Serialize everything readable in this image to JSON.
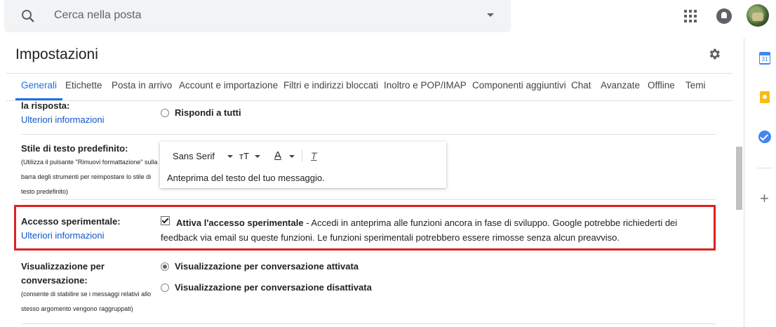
{
  "search": {
    "placeholder": "Cerca nella posta"
  },
  "header": {
    "title": "Impostazioni"
  },
  "tabs": [
    {
      "label": "Generali",
      "active": true
    },
    {
      "label": "Etichette"
    },
    {
      "label": "Posta in arrivo"
    },
    {
      "label": "Account e importazione"
    },
    {
      "label": "Filtri e indirizzi bloccati"
    },
    {
      "label": "Inoltro e POP/IMAP"
    },
    {
      "label": "Componenti aggiuntivi"
    },
    {
      "label": "Chat"
    },
    {
      "label": "Avanzate"
    },
    {
      "label": "Offline"
    },
    {
      "label": "Temi"
    }
  ],
  "reply": {
    "label": "la risposta:",
    "link": "Ulteriori informazioni",
    "option": "Rispondi a tutti"
  },
  "text_style": {
    "label": "Stile di testo predefinito:",
    "note_1": "(Utilizza il pulsante \"Rimuovi formattazione\" sulla",
    "note_2": "barra degli strumenti per reimpostare lo stile di",
    "note_3": "testo predefinito)",
    "font": "Sans Serif",
    "size_icon": "тT",
    "color_icon": "A",
    "clear_icon": "T",
    "preview": "Anteprima del testo del tuo messaggio."
  },
  "experimental": {
    "label": "Accesso sperimentale:",
    "link": "Ulteriori informazioni",
    "checked": true,
    "option": "Attiva l'accesso sperimentale",
    "description": " - Accedi in anteprima alle funzioni ancora in fase di sviluppo. Google potrebbe richiederti dei feedback via email su queste funzioni. Le funzioni sperimentali potrebbero essere rimosse senza alcun preavviso."
  },
  "conversation": {
    "label_1": "Visualizzazione per",
    "label_2": "conversazione:",
    "note_1": "(consente di stabilire se i messaggi relativi allo",
    "note_2": "stesso argomento vengono raggruppati)",
    "option_on": "Visualizzazione per conversazione attivata",
    "option_off": "Visualizzazione per conversazione disattivata",
    "selected": "on"
  },
  "side_panel": {
    "calendar_icon": "31",
    "icons": [
      "calendar-icon",
      "keep-icon",
      "tasks-icon",
      "add-icon"
    ],
    "add_label": "+"
  }
}
